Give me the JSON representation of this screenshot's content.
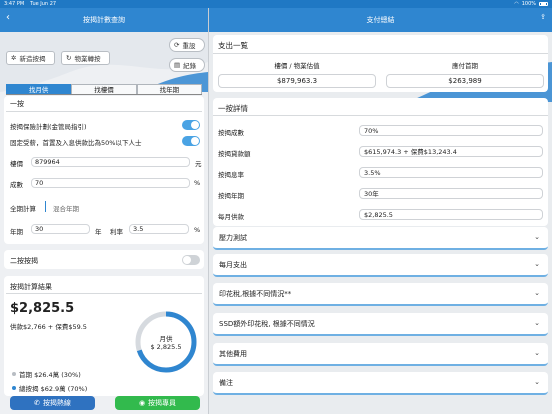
{
  "status": {
    "time": "3:47 PM",
    "date": "Tue Jun 27",
    "battery": "100%"
  },
  "left": {
    "title": "按揭計數查詢",
    "back_icon": "chevron-left-icon",
    "buttons": {
      "new_mortgage": "新造按揭",
      "transfer": "物業轉按",
      "reset": "重設",
      "record": "紀錄"
    },
    "tabs": [
      "找月供",
      "找樓價",
      "找年期"
    ],
    "active_tab": 0,
    "first_mortgage": {
      "title": "一按",
      "insurance_label": "按揭保險計劃(金管局指引)",
      "fixed_income_label": "固定受薪，首置及入息供款比為50%以下人士",
      "price_label": "樓價",
      "price_value": "879964",
      "price_unit": "元",
      "ratio_label": "成數",
      "ratio_value": "70",
      "ratio_unit": "%",
      "calc_full": "全期計算",
      "calc_mixed": "混合年期",
      "years_label": "年期",
      "years_value": "30",
      "years_unit": "年",
      "rate_label": "利率",
      "rate_value": "3.5",
      "rate_unit": "%"
    },
    "second_mortgage": {
      "title": "二按按揭"
    },
    "result": {
      "title": "按揭計算結果",
      "monthly": "$2,825.5",
      "breakdown": "供款$2,766 + 保費$59.5",
      "donut_label": "月供",
      "donut_value": "$ 2,825.5",
      "down_payment": "首期 $26.4萬 (30%)",
      "total_loan": "總按揭 $62.9萬 (70%)",
      "donut_fraction": 0.7
    },
    "footer": {
      "hotline": "按揭熱線",
      "agent": "按揭專員"
    }
  },
  "right": {
    "title": "支付總結",
    "share_icon": "share-icon",
    "overview": {
      "title": "支出一覧",
      "col1_label": "樓價 / 物業估值",
      "col1_value": "$879,963.3",
      "col2_label": "應付首期",
      "col2_value": "$263,989"
    },
    "details": {
      "title": "一按詳情",
      "rows": [
        {
          "label": "按揭成數",
          "value": "70%"
        },
        {
          "label": "按揭貸款額",
          "value": "$615,974.3 + 保費$13,243.4"
        },
        {
          "label": "按揭息率",
          "value": "3.5%"
        },
        {
          "label": "按揭年期",
          "value": "30年"
        },
        {
          "label": "每月供款",
          "value": "$2,825.5"
        }
      ]
    },
    "accordions": [
      "壓力測試",
      "每月支出",
      "印花稅,根據不同情況**",
      "SSD額外印花稅, 根據不同情況",
      "其他費用",
      "備注"
    ]
  },
  "colors": {
    "brand_blue": "#2f86d0",
    "toggle_on": "#4aa3e4",
    "whatsapp_green": "#32ba4d",
    "donut_blue": "#2f86d0",
    "donut_grey": "#d6dadf"
  }
}
